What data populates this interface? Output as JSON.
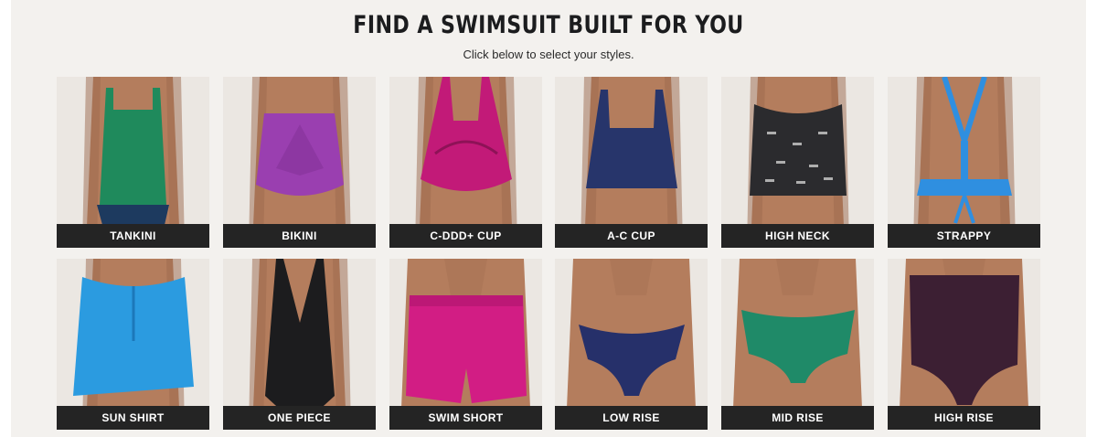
{
  "header": {
    "title": "FIND A SWIMSUIT BUILT FOR YOU",
    "subtitle": "Click below to select your styles."
  },
  "styles": [
    {
      "label": "TANKINI",
      "image": "tankini-photo",
      "color": "#1f8a5c",
      "bottom_color": "#1d3a5f"
    },
    {
      "label": "BIKINI",
      "image": "bikini-photo",
      "color": "#9a3fb0"
    },
    {
      "label": "C-DDD+ CUP",
      "image": "c-ddd-cup-photo",
      "color": "#c21a78"
    },
    {
      "label": "A-C CUP",
      "image": "a-c-cup-photo",
      "color": "#27356b"
    },
    {
      "label": "HIGH NECK",
      "image": "high-neck-photo",
      "color": "#2b2b2e"
    },
    {
      "label": "STRAPPY",
      "image": "strappy-photo",
      "color": "#2f8fe0"
    },
    {
      "label": "SUN SHIRT",
      "image": "sun-shirt-photo",
      "color": "#2b9be0"
    },
    {
      "label": "ONE PIECE",
      "image": "one-piece-photo",
      "color": "#1c1c1e"
    },
    {
      "label": "SWIM SHORT",
      "image": "swim-short-photo",
      "color": "#d21d84"
    },
    {
      "label": "LOW RISE",
      "image": "low-rise-photo",
      "color": "#26306a"
    },
    {
      "label": "MID RISE",
      "image": "mid-rise-photo",
      "color": "#1f8a68"
    },
    {
      "label": "HIGH RISE",
      "image": "high-rise-photo",
      "color": "#3c1f33"
    }
  ],
  "colors": {
    "background": "#f3f1ee",
    "label_bar": "#242424",
    "skin": "#b47d5d",
    "photo_bg": "#ebe7e2"
  }
}
